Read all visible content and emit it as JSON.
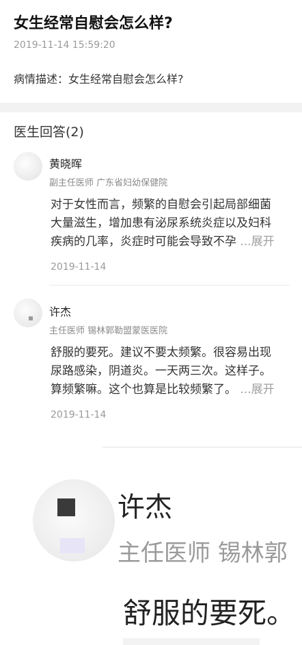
{
  "question": {
    "title": "女生经常自慰会怎么样?",
    "time": "2019-11-14 15:59:20",
    "description": "病情描述：女生经常自慰会怎么样?"
  },
  "answers_header": "医生回答(2)",
  "answers": [
    {
      "name": "黄晓晖",
      "title": "副主任医师 广东省妇幼保健院",
      "body_lines": [
        "对于女性而言，频繁的自慰会引起局部细菌",
        "大量滋生，增加患有泌尿系统炎症以及妇科",
        "疾病的几率，炎症时可能会导致不孕"
      ],
      "more": "...展开",
      "date": "2019-11-14"
    },
    {
      "name": "许杰",
      "title": "主任医师 锡林郭勒盟蒙医医院",
      "body_lines": [
        "舒服的要死。建议不要太频繁。很容易出现",
        "尿路感染，阴道炎。一天两三次。这样子。",
        "算频繁嘛。这个也算是比较频繁了。"
      ],
      "more": "...展开",
      "date": "2019-11-14"
    }
  ],
  "zoom": {
    "name": "许杰",
    "title": "主任医师 锡林郭",
    "body": "舒服的要死。"
  }
}
